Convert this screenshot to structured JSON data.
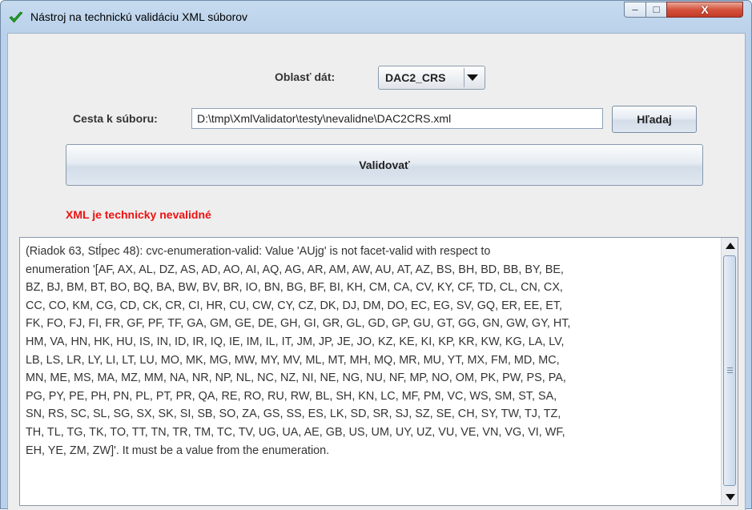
{
  "window": {
    "title": "Nástroj na technickú validáciu XML súborov",
    "icon": "green-checkmark-icon",
    "controls": {
      "minimize": "–",
      "maximize": "□",
      "close": "X"
    }
  },
  "form": {
    "data_area": {
      "label": "Oblasť dát:",
      "selected": "DAC2_CRS"
    },
    "file_path": {
      "label": "Cesta k súboru:",
      "value": "D:\\tmp\\XmlValidator\\testy\\nevalidne\\DAC2CRS.xml"
    },
    "search_button": "Hľadaj",
    "validate_button": "Validovať"
  },
  "status": {
    "text": "XML je technicky nevalidné",
    "color": "#ee1111"
  },
  "output": {
    "text": "(Riadok 63, Stĺpec 48): cvc-enumeration-valid: Value 'AUjg' is not facet-valid with respect to\nenumeration '[AF, AX, AL, DZ, AS, AD, AO, AI, AQ, AG, AR, AM, AW, AU, AT, AZ, BS, BH, BD, BB, BY, BE,\nBZ, BJ, BM, BT, BO, BQ, BA, BW, BV, BR, IO, BN, BG, BF, BI, KH, CM, CA, CV, KY, CF, TD, CL, CN, CX,\nCC, CO, KM, CG, CD, CK, CR, CI, HR, CU, CW, CY, CZ, DK, DJ, DM, DO, EC, EG, SV, GQ, ER, EE, ET,\nFK, FO, FJ, FI, FR, GF, PF, TF, GA, GM, GE, DE, GH, GI, GR, GL, GD, GP, GU, GT, GG, GN, GW, GY, HT,\nHM, VA, HN, HK, HU, IS, IN, ID, IR, IQ, IE, IM, IL, IT, JM, JP, JE, JO, KZ, KE, KI, KP, KR, KW, KG, LA, LV,\nLB, LS, LR, LY, LI, LT, LU, MO, MK, MG, MW, MY, MV, ML, MT, MH, MQ, MR, MU, YT, MX, FM, MD, MC,\nMN, ME, MS, MA, MZ, MM, NA, NR, NP, NL, NC, NZ, NI, NE, NG, NU, NF, MP, NO, OM, PK, PW, PS, PA,\nPG, PY, PE, PH, PN, PL, PT, PR, QA, RE, RO, RU, RW, BL, SH, KN, LC, MF, PM, VC, WS, SM, ST, SA,\nSN, RS, SC, SL, SG, SX, SK, SI, SB, SO, ZA, GS, SS, ES, LK, SD, SR, SJ, SZ, SE, CH, SY, TW, TJ, TZ,\nTH, TL, TG, TK, TO, TT, TN, TR, TM, TC, TV, UG, UA, AE, GB, US, UM, UY, UZ, VU, VE, VN, VG, VI, WF,\nEH, YE, ZM, ZW]'. It must be a value from the enumeration."
  }
}
